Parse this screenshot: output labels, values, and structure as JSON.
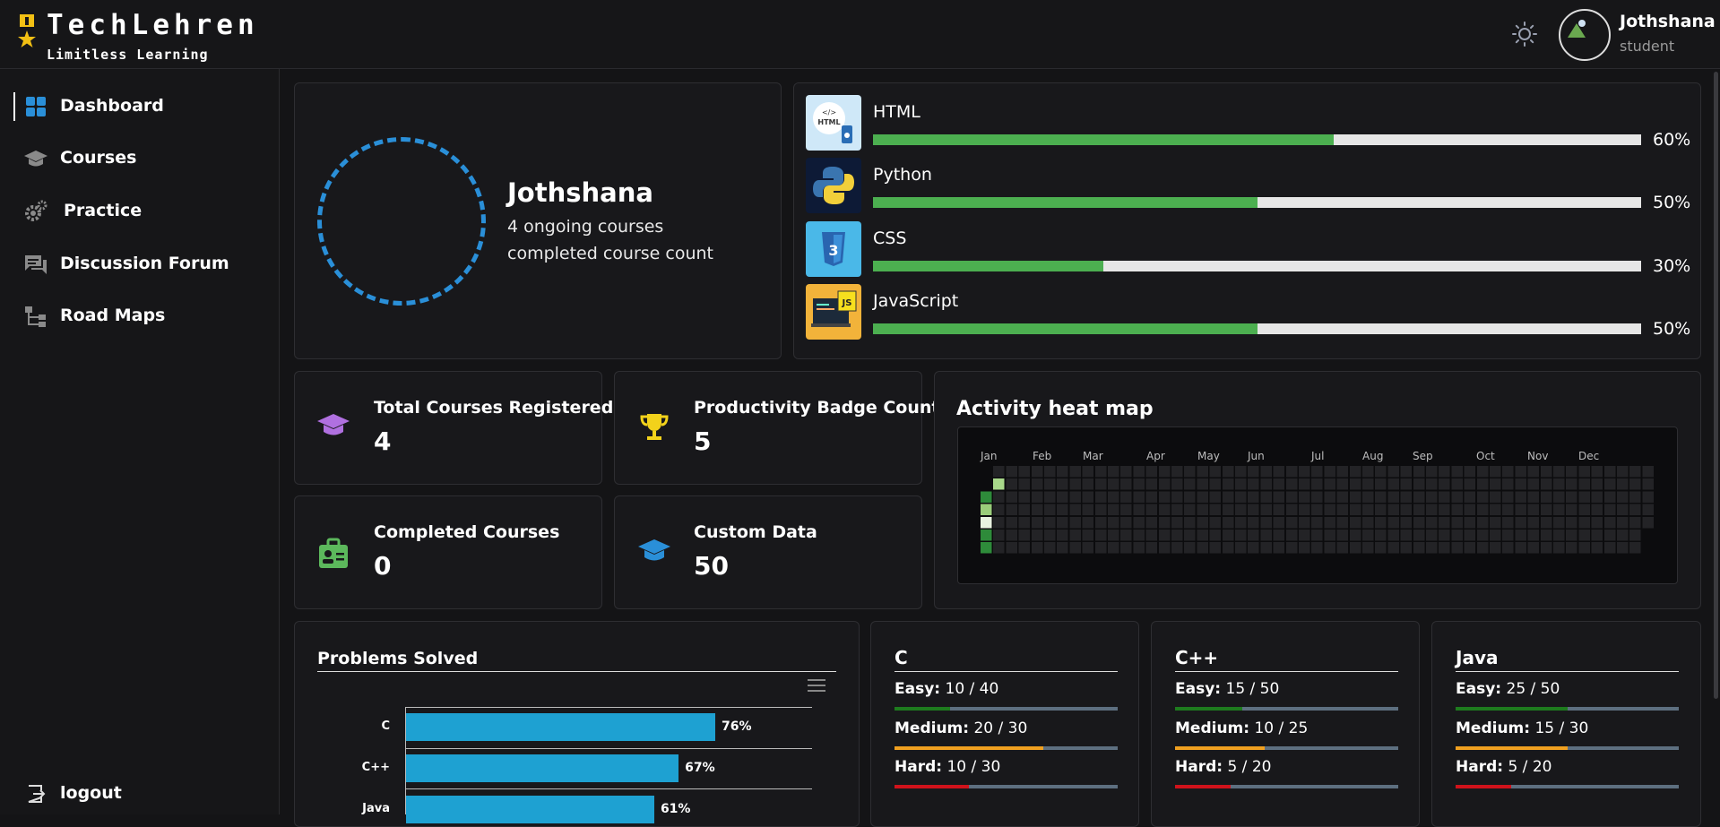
{
  "brand": {
    "title": "TechLehren",
    "subtitle": "Limitless Learning"
  },
  "user": {
    "name": "Jothshana",
    "role": "student"
  },
  "sidebar": {
    "items": [
      {
        "label": "Dashboard",
        "icon": "dashboard-icon"
      },
      {
        "label": "Courses",
        "icon": "graduation-cap-icon"
      },
      {
        "label": "Practice",
        "icon": "gears-icon"
      },
      {
        "label": "Discussion Forum",
        "icon": "forum-icon"
      },
      {
        "label": "Road Maps",
        "icon": "roadmap-icon"
      }
    ],
    "logout": "logout"
  },
  "profile": {
    "name": "Jothshana",
    "line1": "4 ongoing courses",
    "line2": "completed course count"
  },
  "skills": [
    {
      "name": "HTML",
      "pct_label": "60%",
      "value": 60
    },
    {
      "name": "Python",
      "pct_label": "50%",
      "value": 50
    },
    {
      "name": "CSS",
      "pct_label": "30%",
      "value": 30
    },
    {
      "name": "JavaScript",
      "pct_label": "50%",
      "value": 50
    }
  ],
  "stats": [
    {
      "label": "Total Courses Registered",
      "value": "4",
      "icon": "graduation-cap-icon",
      "color": "#b070e0"
    },
    {
      "label": "Productivity Badge Count",
      "value": "5",
      "icon": "trophy-icon",
      "color": "#f2d21b"
    },
    {
      "label": "Completed Courses",
      "value": "0",
      "icon": "id-badge-icon",
      "color": "#5cb85c"
    },
    {
      "label": "Custom Data",
      "value": "50",
      "icon": "graduation-cap-icon",
      "color": "#2a8fd8"
    }
  ],
  "heatmap": {
    "title": "Activity heat map",
    "months": [
      "Jan",
      "Feb",
      "Mar",
      "Apr",
      "May",
      "Jun",
      "Jul",
      "Aug",
      "Sep",
      "Oct",
      "Nov",
      "Dec"
    ]
  },
  "problems": {
    "title": "Problems Solved",
    "chart_data": {
      "type": "bar",
      "orientation": "horizontal",
      "categories": [
        "C",
        "C++",
        "Java"
      ],
      "values": [
        76,
        67,
        61
      ],
      "labels": [
        "76%",
        "67%",
        "61%"
      ],
      "xlim": [
        0,
        100
      ]
    }
  },
  "languages": [
    {
      "name": "C",
      "levels": [
        {
          "label": "Easy:",
          "value": "10 / 40",
          "solved": 10,
          "total": 40,
          "color": "#1e7b1e"
        },
        {
          "label": "Medium:",
          "value": "20 / 30",
          "solved": 20,
          "total": 30,
          "color": "#f0a020"
        },
        {
          "label": "Hard:",
          "value": "10 / 30",
          "solved": 10,
          "total": 30,
          "color": "#d0121b"
        }
      ]
    },
    {
      "name": "C++",
      "levels": [
        {
          "label": "Easy:",
          "value": "15 / 50",
          "solved": 15,
          "total": 50,
          "color": "#1e7b1e"
        },
        {
          "label": "Medium:",
          "value": "10 / 25",
          "solved": 10,
          "total": 25,
          "color": "#f0a020"
        },
        {
          "label": "Hard:",
          "value": "5 / 20",
          "solved": 5,
          "total": 20,
          "color": "#d0121b"
        }
      ]
    },
    {
      "name": "Java",
      "levels": [
        {
          "label": "Easy:",
          "value": "25 / 50",
          "solved": 25,
          "total": 50,
          "color": "#1e7b1e"
        },
        {
          "label": "Medium:",
          "value": "15 / 30",
          "solved": 15,
          "total": 30,
          "color": "#f0a020"
        },
        {
          "label": "Hard:",
          "value": "5 / 20",
          "solved": 5,
          "total": 20,
          "color": "#d0121b"
        }
      ]
    }
  ],
  "colors": {
    "accent": "#2a8fd8",
    "progress": "#4caf50",
    "bar": "#1ea1d2"
  }
}
